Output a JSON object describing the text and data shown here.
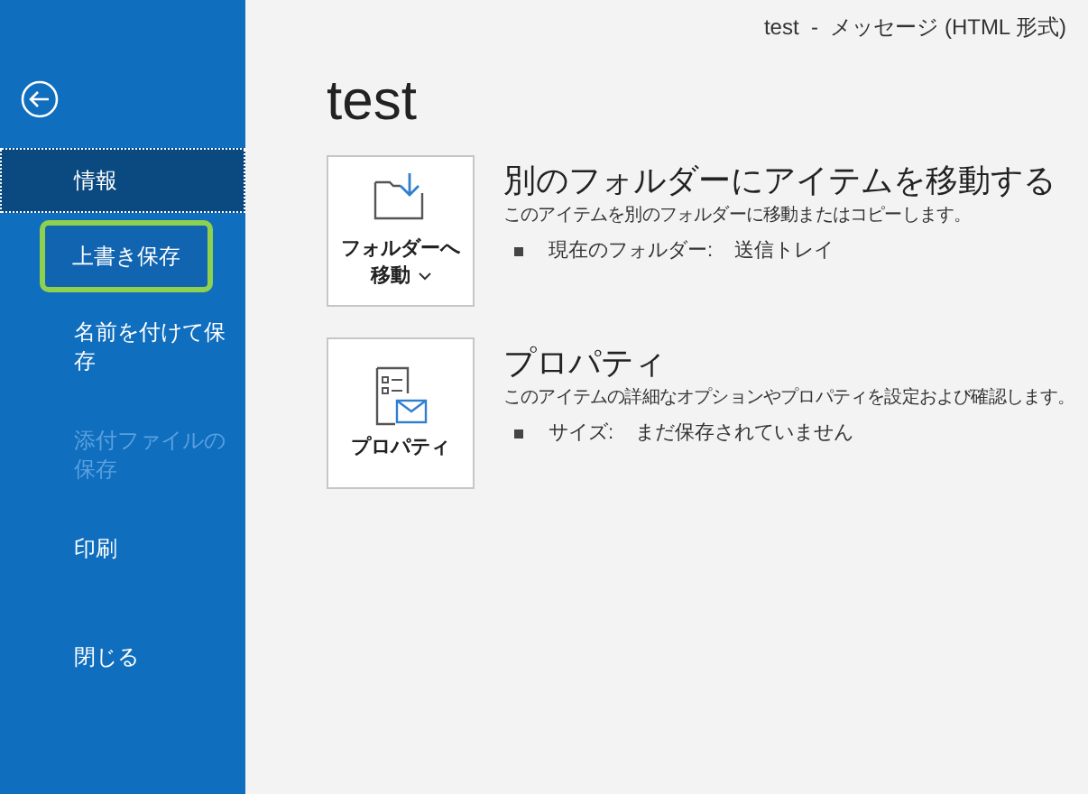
{
  "window": {
    "title": "test  -  メッセージ (HTML 形式)"
  },
  "sidebar": {
    "items": [
      {
        "label": "情報",
        "selected": true,
        "disabled": false,
        "highlighted": false
      },
      {
        "label": "上書き保存",
        "selected": false,
        "disabled": false,
        "highlighted": true
      },
      {
        "label": "名前を付けて保存",
        "selected": false,
        "disabled": false,
        "highlighted": false
      },
      {
        "label": "添付ファイルの保存",
        "selected": false,
        "disabled": true,
        "highlighted": false
      },
      {
        "label": "印刷",
        "selected": false,
        "disabled": false,
        "highlighted": false
      },
      {
        "label": "閉じる",
        "selected": false,
        "disabled": false,
        "highlighted": false
      }
    ]
  },
  "heading": "test",
  "sections": [
    {
      "kind": "move",
      "button": "フォルダーへ移動",
      "title": "別のフォルダーにアイテムを移動する",
      "description": "このアイテムを別のフォルダーに移動またはコピーします。",
      "details": [
        {
          "label": "現在のフォルダー:",
          "value": "送信トレイ"
        }
      ]
    },
    {
      "kind": "properties",
      "button": "プロパティ",
      "title": "プロパティ",
      "description": "このアイテムの詳細なオプションやプロパティを設定および確認します。",
      "details": [
        {
          "label": "サイズ:",
          "value": "まだ保存されていません"
        }
      ]
    }
  ]
}
